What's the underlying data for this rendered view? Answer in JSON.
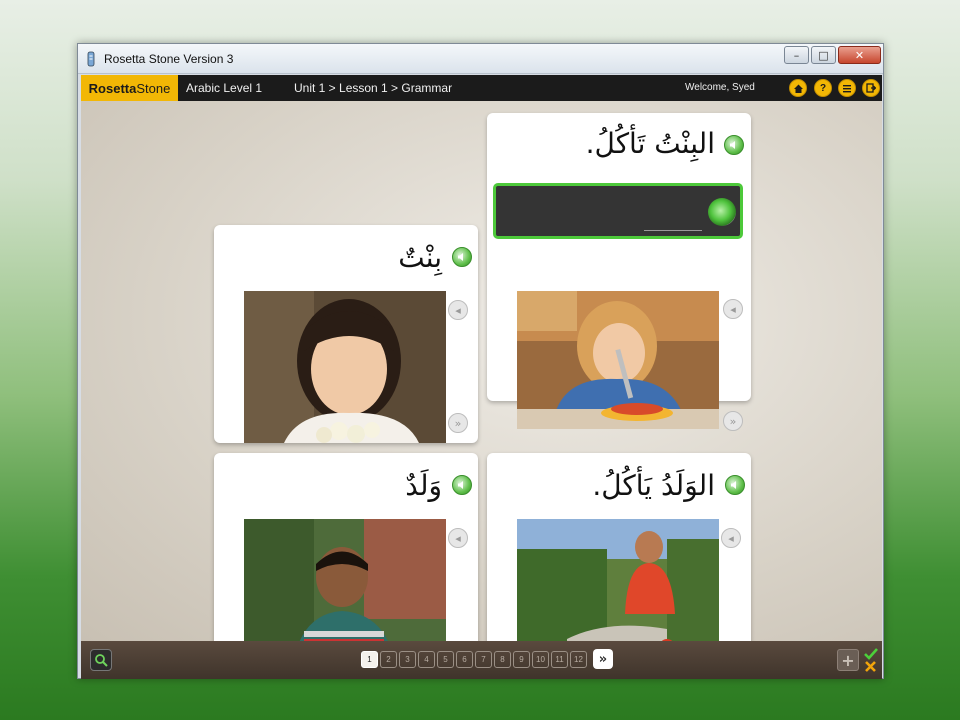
{
  "window": {
    "title": "Rosetta Stone Version 3",
    "controls": {
      "minimize": "–",
      "maximize": "□",
      "close": "✕"
    }
  },
  "appbar": {
    "logo_bold": "Rosetta",
    "logo_light": "Stone",
    "course": "Arabic Level 1",
    "breadcrumb": "Unit 1 > Lesson 1 > Grammar",
    "welcome": "Welcome, Syed",
    "icons": [
      "home-icon",
      "help-icon",
      "menu-icon",
      "exit-icon"
    ]
  },
  "cards": {
    "prompt": {
      "text": "البِنْتُ تَأكُلُ."
    },
    "girl": {
      "text": "بِنْتٌ"
    },
    "girl_eating": {
      "text": ""
    },
    "boy": {
      "text": "وَلَدٌ"
    },
    "boy_eating": {
      "text": "الوَلَدُ يَأكُلُ."
    }
  },
  "pager": {
    "pages": [
      "1",
      "2",
      "3",
      "4",
      "5",
      "6",
      "7",
      "8",
      "9",
      "10",
      "11",
      "12"
    ],
    "current": "1",
    "next_label": "»"
  },
  "colors": {
    "accent": "#f2b705",
    "active_green": "#4dc93a",
    "bar_brown": "#4a3d33"
  }
}
